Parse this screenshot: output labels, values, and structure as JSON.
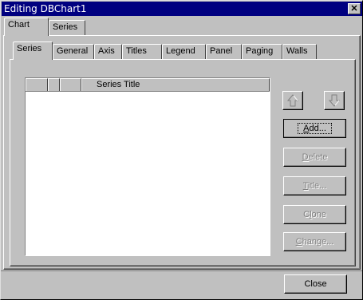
{
  "window": {
    "title": "Editing DBChart1",
    "close_glyph": "✕"
  },
  "outer_tabs": [
    {
      "label": "Chart",
      "active": true
    },
    {
      "label": "Series",
      "active": false
    }
  ],
  "inner_tabs": [
    {
      "label": "Series",
      "active": true
    },
    {
      "label": "General",
      "active": false
    },
    {
      "label": "Axis",
      "active": false
    },
    {
      "label": "Titles",
      "active": false
    },
    {
      "label": "Legend",
      "active": false
    },
    {
      "label": "Panel",
      "active": false
    },
    {
      "label": "Paging",
      "active": false
    },
    {
      "label": "Walls",
      "active": false
    }
  ],
  "series_list": {
    "column_title": "Series Title",
    "items": []
  },
  "move_buttons": {
    "up_icon": "move-up-arrow",
    "down_icon": "move-down-arrow"
  },
  "buttons": {
    "add": {
      "label": "Add...",
      "mnemonic": "A",
      "rest": "dd..."
    },
    "delete": {
      "label": "Delete",
      "mnemonic": "D",
      "rest": "elete"
    },
    "title": {
      "label": "Title...",
      "mnemonic": "T",
      "rest": "itle..."
    },
    "clone": {
      "label": "Clone",
      "pre": "C",
      "mnemonic": "l",
      "rest": "one"
    },
    "change": {
      "label": "Change...",
      "mnemonic": "C",
      "rest": "hange..."
    },
    "close": {
      "label": "Close"
    }
  },
  "colors": {
    "title_bar": "#000080",
    "face": "#c0c0c0",
    "disabled_text": "#808080"
  }
}
